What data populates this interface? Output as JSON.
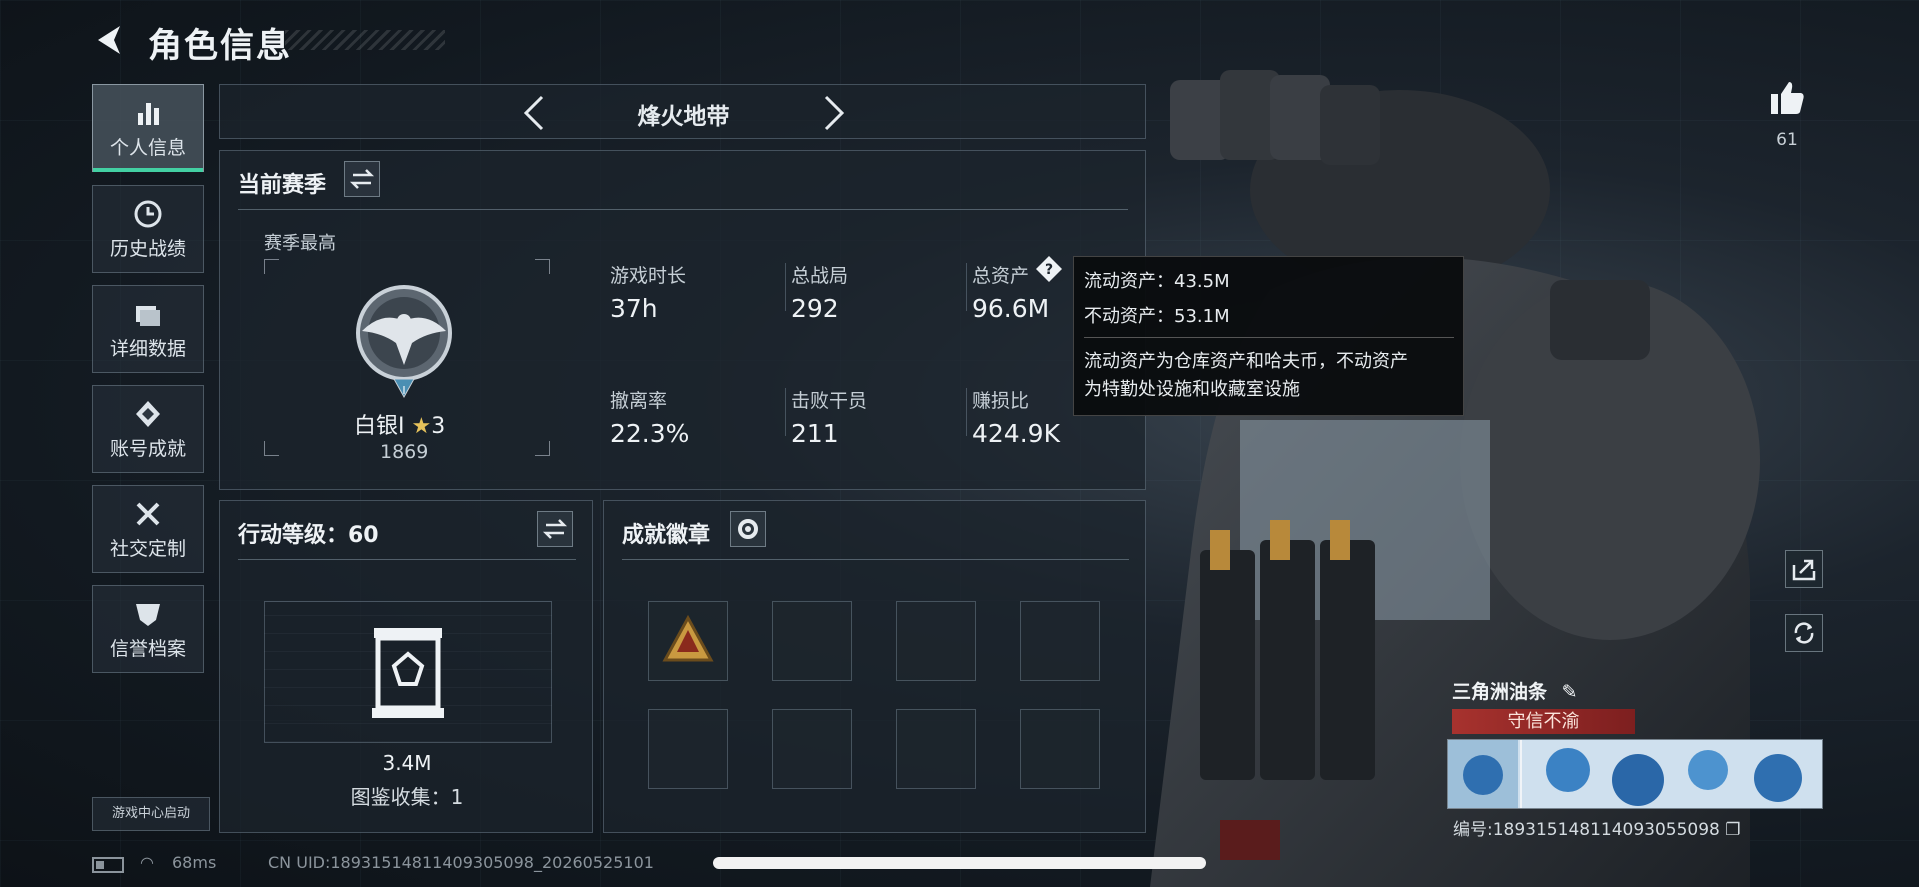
{
  "header": {
    "title": "角色信息"
  },
  "sidebar": {
    "items": [
      {
        "label": "个人信息",
        "icon": "bar-chart-icon",
        "active": true
      },
      {
        "label": "历史战绩",
        "icon": "clock-icon"
      },
      {
        "label": "详细数据",
        "icon": "folder-icon"
      },
      {
        "label": "账号成就",
        "icon": "achievement-icon"
      },
      {
        "label": "社交定制",
        "icon": "tools-icon"
      },
      {
        "label": "信誉档案",
        "icon": "shield-icon"
      }
    ],
    "launch_label": "游戏中心启动"
  },
  "mode_selector": {
    "label": "烽火地带"
  },
  "season": {
    "title": "当前赛季",
    "best_label": "赛季最高",
    "rank_name": "白银I",
    "rank_stars": "3",
    "rank_score": "1869",
    "stats": [
      {
        "label": "游戏时长",
        "value": "37h"
      },
      {
        "label": "总战局",
        "value": "292"
      },
      {
        "label": "总资产",
        "value": "96.6M"
      },
      {
        "label": "撤离率",
        "value": "22.3%"
      },
      {
        "label": "击败干员",
        "value": "211"
      },
      {
        "label": "赚损比",
        "value": "424.9K"
      }
    ]
  },
  "asset_tooltip": {
    "line1": "流动资产：43.5M",
    "line2": "不动资产：53.1M",
    "desc1": "流动资产为仓库资产和哈夫币，不动资产",
    "desc2": "为特勤处设施和收藏室设施"
  },
  "action_level": {
    "title": "行动等级：60",
    "value": "3.4M",
    "collection": "图鉴收集：1"
  },
  "badges": {
    "title": "成就徽章",
    "slot_count": 8
  },
  "profile": {
    "likes": "61",
    "name": "三角洲油条",
    "title": "守信不渝",
    "id": "编号:1893151481140930550​98"
  },
  "footer": {
    "ping": "68ms",
    "uid": "CN UID:18931514811409305098_20260525101"
  },
  "colors": {
    "accent": "#43d0a3",
    "title_banner": "#a7322e",
    "rank_star": "#e6c25b"
  }
}
